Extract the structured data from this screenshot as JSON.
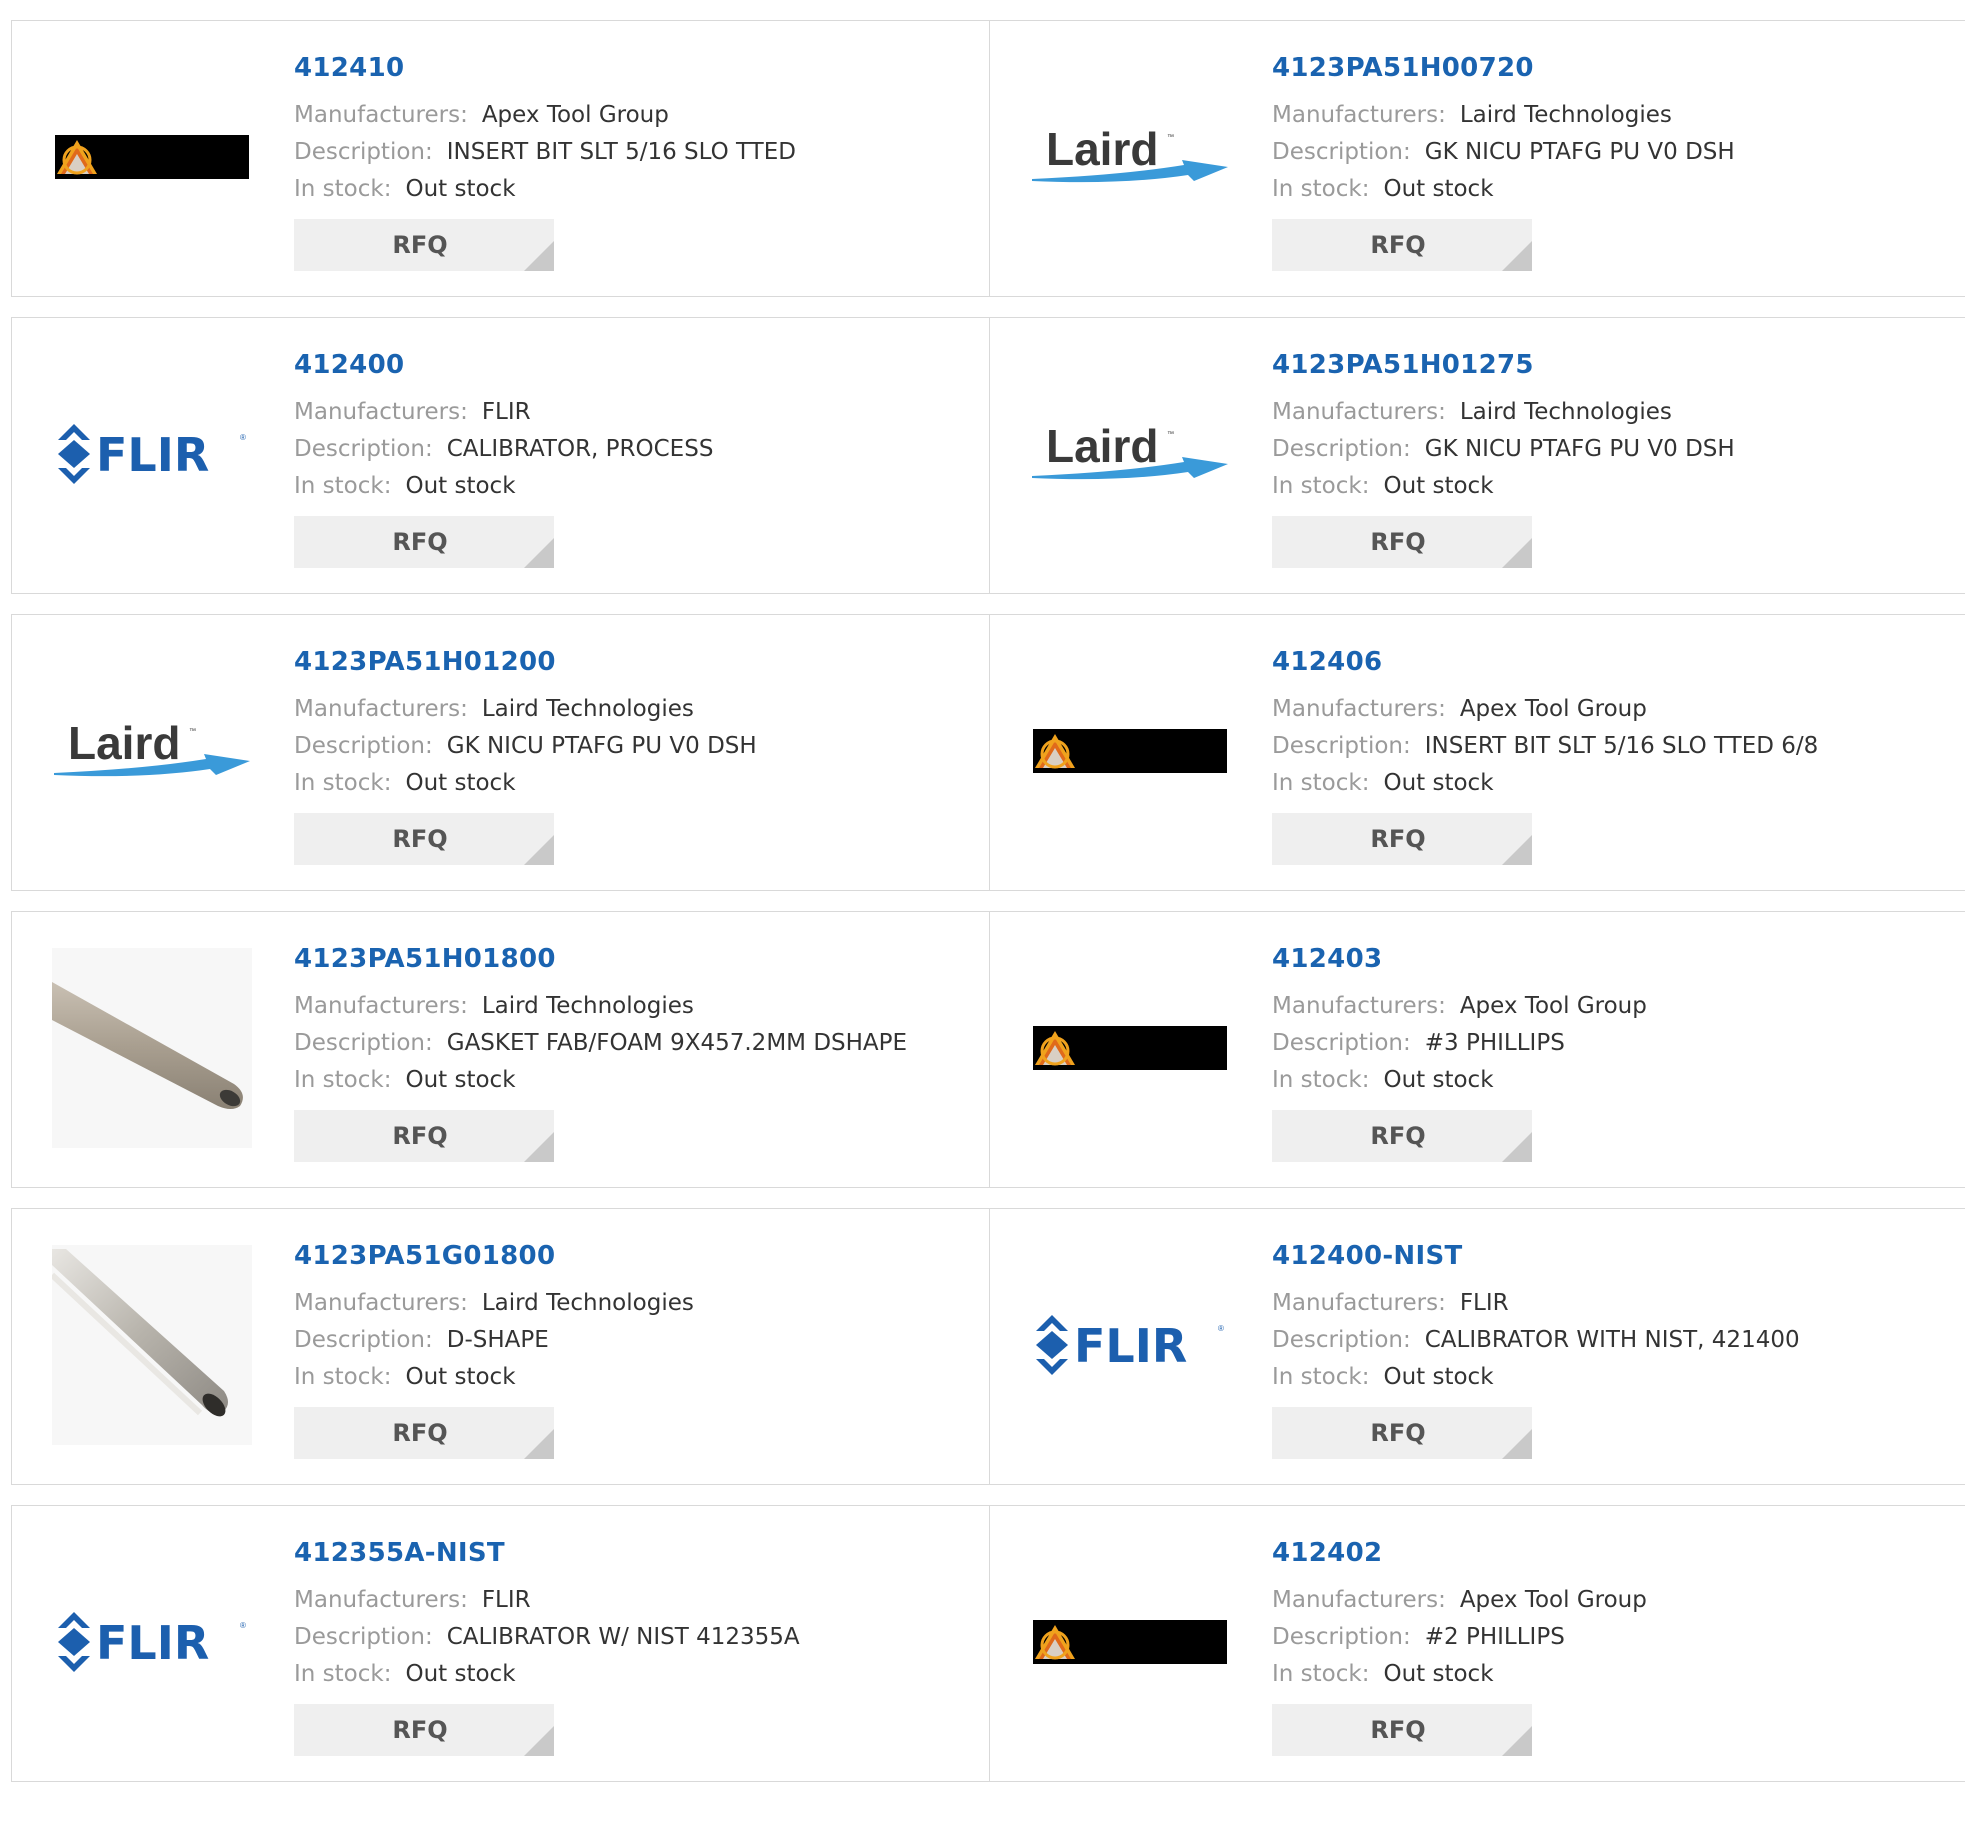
{
  "labels": {
    "manufacturers": "Manufacturers:",
    "description": "Description:",
    "in_stock": "In stock:",
    "rfq": "RFQ"
  },
  "colors": {
    "part_link": "#1a63b0",
    "label_gray": "#9a9a9a",
    "rfq_bg": "#efefef"
  },
  "products": [
    {
      "part": "412410",
      "manufacturer": "Apex Tool Group",
      "description": "INSERT BIT SLT 5/16 SLO TTED",
      "stock": "Out stock",
      "logo": "apex-logo"
    },
    {
      "part": "4123PA51H00720",
      "manufacturer": "Laird Technologies",
      "description": "GK NICU PTAFG PU V0 DSH",
      "stock": "Out stock",
      "logo": "laird-logo"
    },
    {
      "part": "412400",
      "manufacturer": "FLIR",
      "description": "CALIBRATOR, PROCESS",
      "stock": "Out stock",
      "logo": "flir-logo"
    },
    {
      "part": "4123PA51H01275",
      "manufacturer": "Laird Technologies",
      "description": "GK NICU PTAFG PU V0 DSH",
      "stock": "Out stock",
      "logo": "laird-logo"
    },
    {
      "part": "4123PA51H01200",
      "manufacturer": "Laird Technologies",
      "description": "GK NICU PTAFG PU V0 DSH",
      "stock": "Out stock",
      "logo": "laird-logo"
    },
    {
      "part": "412406",
      "manufacturer": "Apex Tool Group",
      "description": "INSERT BIT SLT 5/16 SLO TTED 6/8",
      "stock": "Out stock",
      "logo": "apex-logo"
    },
    {
      "part": "4123PA51H01800",
      "manufacturer": "Laird Technologies",
      "description": "GASKET FAB/FOAM 9X457.2MM DSHAPE",
      "stock": "Out stock",
      "logo": "gasket-photo-dark"
    },
    {
      "part": "412403",
      "manufacturer": "Apex Tool Group",
      "description": "#3 PHILLIPS",
      "stock": "Out stock",
      "logo": "apex-logo"
    },
    {
      "part": "4123PA51G01800",
      "manufacturer": "Laird Technologies",
      "description": "D-SHAPE",
      "stock": "Out stock",
      "logo": "gasket-photo-silver"
    },
    {
      "part": "412400-NIST",
      "manufacturer": "FLIR",
      "description": "CALIBRATOR WITH NIST, 421400",
      "stock": "Out stock",
      "logo": "flir-logo"
    },
    {
      "part": "412355A-NIST",
      "manufacturer": "FLIR",
      "description": "CALIBRATOR W/ NIST 412355A",
      "stock": "Out stock",
      "logo": "flir-logo"
    },
    {
      "part": "412402",
      "manufacturer": "Apex Tool Group",
      "description": "#2 PHILLIPS",
      "stock": "Out stock",
      "logo": "apex-logo"
    }
  ]
}
